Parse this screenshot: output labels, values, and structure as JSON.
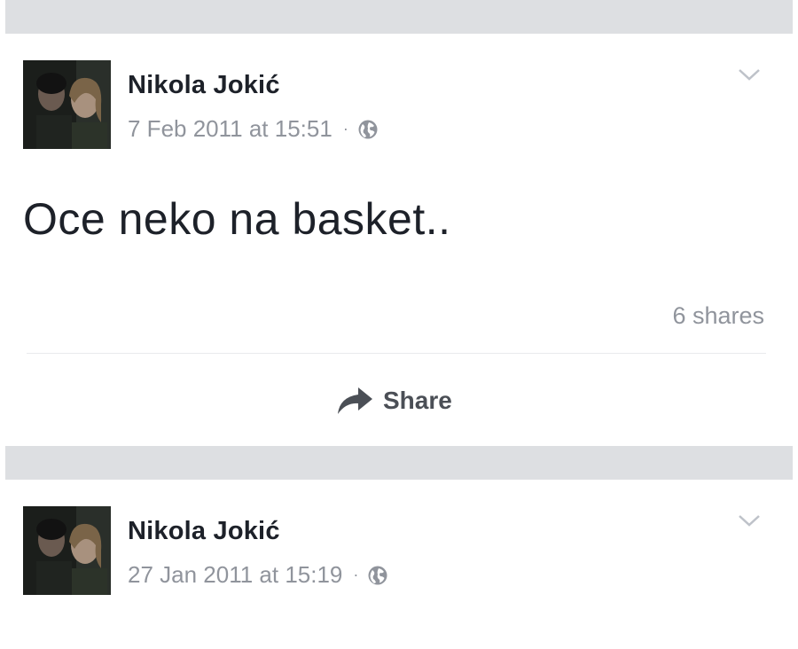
{
  "posts": [
    {
      "author": "Nikola Jokić",
      "timestamp": "7 Feb 2011 at 15:51",
      "separator": "·",
      "privacy_icon": "globe-icon",
      "menu_icon": "chevron-down-icon",
      "message": "Oce neko na basket..",
      "shares": "6 shares",
      "share_action": {
        "label": "Share",
        "icon": "share-arrow-icon"
      }
    },
    {
      "author": "Nikola Jokić",
      "timestamp": "27 Jan 2011 at 15:19",
      "separator": "·",
      "privacy_icon": "globe-icon",
      "menu_icon": "chevron-down-icon"
    }
  ],
  "colors": {
    "separator_band": "#dddfe2",
    "author_text": "#1d2129",
    "meta_text": "#90949c",
    "action_text": "#4b4f56"
  }
}
